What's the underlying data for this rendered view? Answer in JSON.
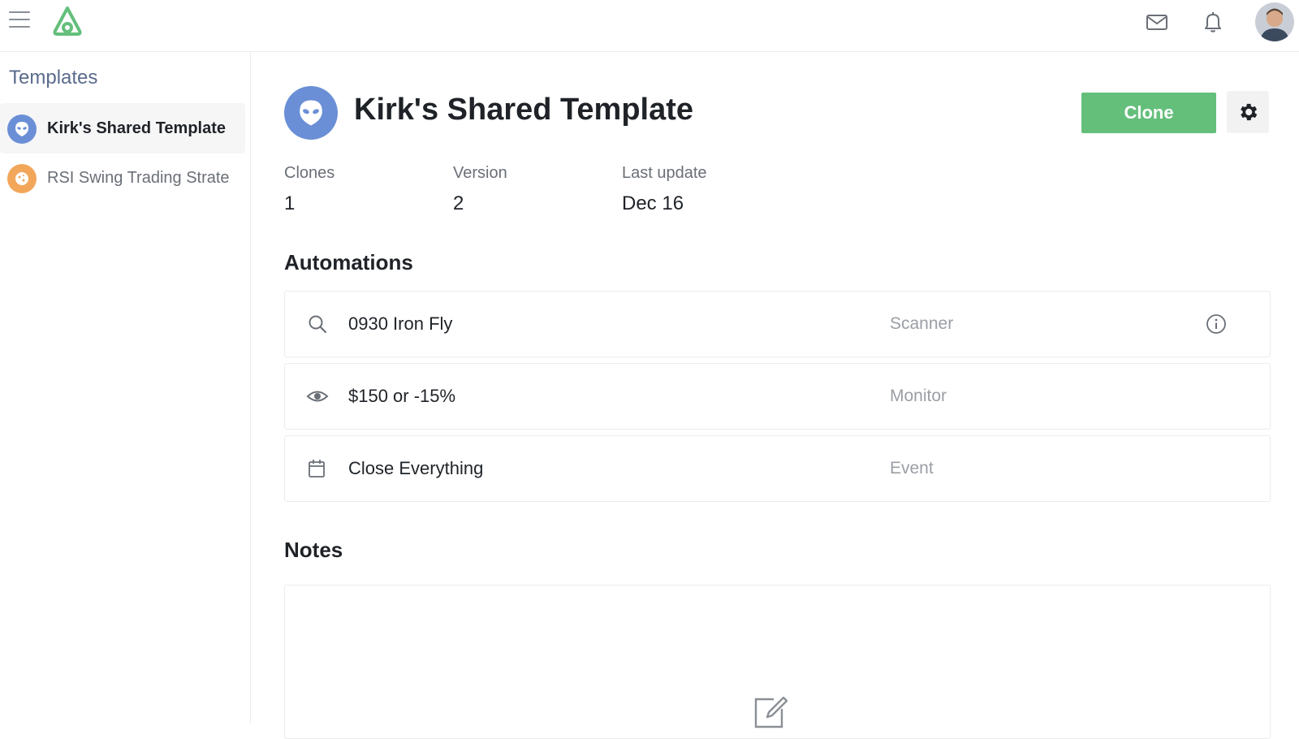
{
  "header": {
    "icons": [
      "hamburger-menu-icon",
      "brand-logo",
      "mail-icon",
      "bell-icon",
      "user-avatar"
    ],
    "brand_color": "#64bf7b"
  },
  "sidebar": {
    "title": "Templates",
    "items": [
      {
        "label": "Kirk's Shared Template",
        "icon": "alien-icon",
        "icon_color": "#6a8fd6",
        "active": true
      },
      {
        "label": "RSI Swing Trading Strate",
        "icon": "cookie-icon",
        "icon_color": "#f2a65a",
        "active": false
      }
    ]
  },
  "template": {
    "title": "Kirk's Shared Template",
    "icon": "alien-icon",
    "clone_label": "Clone",
    "settings_icon": "gear-icon",
    "stats": [
      {
        "label": "Clones",
        "value": "1"
      },
      {
        "label": "Version",
        "value": "2"
      },
      {
        "label": "Last update",
        "value": "Dec 16"
      }
    ]
  },
  "automations": {
    "title": "Automations",
    "rows": [
      {
        "name": "0930 Iron Fly",
        "type": "Scanner",
        "icon": "search-icon",
        "has_info": true
      },
      {
        "name": "$150 or -15%",
        "type": "Monitor",
        "icon": "eye-icon",
        "has_info": false
      },
      {
        "name": "Close Everything",
        "type": "Event",
        "icon": "calendar-icon",
        "has_info": false
      }
    ]
  },
  "notes": {
    "title": "Notes",
    "icon": "edit-icon"
  },
  "colors": {
    "accent_green": "#64bf7b",
    "template_icon_blue": "#6a8fd6",
    "secondary_icon_orange": "#f2a65a"
  }
}
